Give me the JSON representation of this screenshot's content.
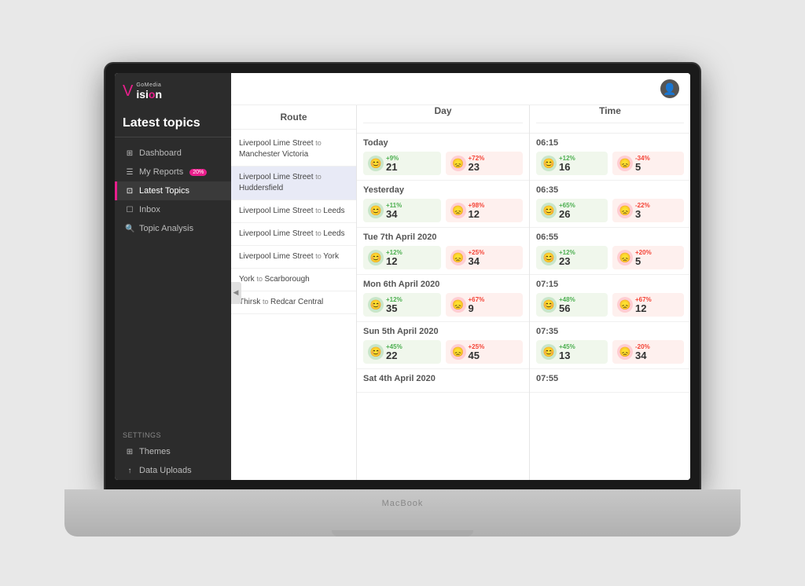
{
  "app": {
    "logo_gomedia": "GoMedia",
    "logo_v": "V",
    "logo_ision": "ision",
    "macbook_label": "MacBook",
    "user_icon": "account_circle"
  },
  "sidebar": {
    "title": "Latest topics",
    "nav_items": [
      {
        "id": "dashboard",
        "label": "Dashboard",
        "icon": "⊞",
        "active": false,
        "badge": null
      },
      {
        "id": "my-reports",
        "label": "My Reports",
        "icon": "⊟",
        "active": false,
        "badge": "20%"
      },
      {
        "id": "latest-topics",
        "label": "Latest Topics",
        "icon": "⊡",
        "active": true,
        "badge": null
      },
      {
        "id": "inbox",
        "label": "Inbox",
        "icon": "☐",
        "active": false,
        "badge": null
      },
      {
        "id": "topic-analysis",
        "label": "Topic Analysis",
        "icon": "🔍",
        "active": false,
        "badge": null
      }
    ],
    "settings_label": "Settings",
    "settings_items": [
      {
        "id": "themes",
        "label": "Themes",
        "icon": "⊞"
      },
      {
        "id": "data-uploads",
        "label": "Data Uploads",
        "icon": "↑"
      }
    ]
  },
  "columns": {
    "route_header": "Route",
    "day_header": "Day",
    "time_header": "Time"
  },
  "routes": [
    {
      "from": "Liverpool Lime Street",
      "to": "Manchester Victoria"
    },
    {
      "from": "Liverpool Lime Street",
      "to": "Huddersfield",
      "selected": true
    },
    {
      "from": "Liverpool Lime Street",
      "to": "Leeds"
    },
    {
      "from": "Liverpool Lime Street",
      "to": "Leeds"
    },
    {
      "from": "Liverpool Lime Street",
      "to": "York"
    },
    {
      "from": "York",
      "to": "Scarborough"
    },
    {
      "from": "Thirsk",
      "to": "Redcar Central"
    }
  ],
  "days": [
    {
      "label": "Today",
      "positive_change": "+9%",
      "positive_count": "21",
      "negative_change": "+72%",
      "negative_count": "23"
    },
    {
      "label": "Yesterday",
      "positive_change": "+11%",
      "positive_count": "34",
      "negative_change": "+98%",
      "negative_count": "12"
    },
    {
      "label": "Tue 7th April 2020",
      "positive_change": "+12%",
      "positive_count": "12",
      "negative_change": "+25%",
      "negative_count": "34"
    },
    {
      "label": "Mon 6th April 2020",
      "positive_change": "+12%",
      "positive_count": "35",
      "negative_change": "+67%",
      "negative_count": "9"
    },
    {
      "label": "Sun 5th April 2020",
      "positive_change": "+45%",
      "positive_count": "22",
      "negative_change": "+25%",
      "negative_count": "45"
    },
    {
      "label": "Sat 4th April 2020",
      "positive_change": "",
      "positive_count": "",
      "negative_change": "",
      "negative_count": ""
    }
  ],
  "times": [
    {
      "label": "06:15",
      "positive_change": "+12%",
      "positive_count": "16",
      "negative_change": "-34%",
      "negative_count": "5"
    },
    {
      "label": "06:35",
      "positive_change": "+65%",
      "positive_count": "26",
      "negative_change": "-22%",
      "negative_count": "3"
    },
    {
      "label": "06:55",
      "positive_change": "+12%",
      "positive_count": "23",
      "negative_change": "+20%",
      "negative_count": "5"
    },
    {
      "label": "07:15",
      "positive_change": "+48%",
      "positive_count": "56",
      "negative_change": "+67%",
      "negative_count": "12"
    },
    {
      "label": "07:35",
      "positive_change": "+45%",
      "positive_count": "13",
      "negative_change": "-20%",
      "negative_count": "34"
    },
    {
      "label": "07:55",
      "positive_change": "",
      "positive_count": "",
      "negative_change": "",
      "negative_count": ""
    }
  ]
}
